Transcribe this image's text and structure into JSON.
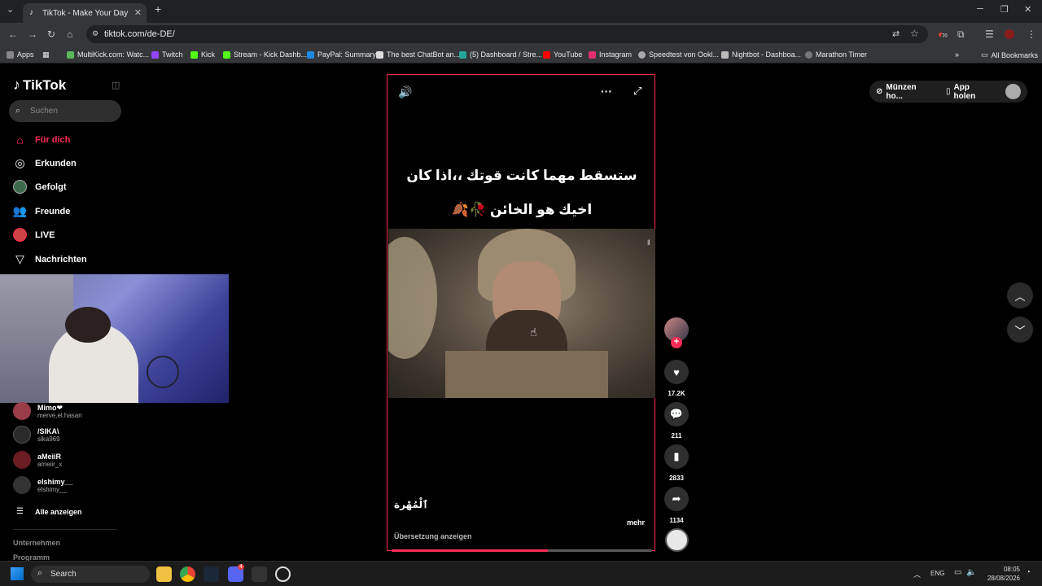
{
  "browser": {
    "tab_title": "TikTok - Make Your Day",
    "url": "tiktok.com/de-DE/",
    "bookmarks": [
      {
        "label": "Apps",
        "color": "#888"
      },
      {
        "label": "MultiKick.com: Watc...",
        "color": "#5cb85c"
      },
      {
        "label": "Twitch",
        "color": "#9146ff"
      },
      {
        "label": "Kick",
        "color": "#53fc18"
      },
      {
        "label": "Stream - Kick Dashb...",
        "color": "#53fc18"
      },
      {
        "label": "PayPal: Summary",
        "color": "#1e88e5"
      },
      {
        "label": "The best ChatBot an...",
        "color": "#ddd"
      },
      {
        "label": "(5) Dashboard / Stre...",
        "color": "#26a69a"
      },
      {
        "label": "YouTube",
        "color": "#ff0000"
      },
      {
        "label": "Instagram",
        "color": "#e1306c"
      },
      {
        "label": "Speedtest von Ookl...",
        "color": "#aaa"
      },
      {
        "label": "Nightbot - Dashboa...",
        "color": "#bbb"
      },
      {
        "label": "Marathon Timer",
        "color": "#777"
      }
    ],
    "all_bookmarks": "All Bookmarks",
    "extension_badge": "70"
  },
  "sidebar": {
    "logo": "TikTok",
    "search_placeholder": "Suchen",
    "nav": [
      {
        "label": "Für dich",
        "icon": "home-icon"
      },
      {
        "label": "Erkunden",
        "icon": "compass-icon"
      },
      {
        "label": "Gefolgt",
        "icon": "following-avatar-icon"
      },
      {
        "label": "Freunde",
        "icon": "friends-icon"
      },
      {
        "label": "LIVE",
        "icon": "live-icon"
      },
      {
        "label": "Nachrichten",
        "icon": "messages-icon"
      }
    ],
    "accounts": [
      {
        "name": "Mimo❤",
        "user": "merve.el.hasan"
      },
      {
        "name": "/SIKA\\",
        "user": "sika969"
      },
      {
        "name": "aMeiiR",
        "user": "ameiir_x"
      },
      {
        "name": "elshimy__",
        "user": "elshimy__"
      }
    ],
    "show_all": "Alle anzeigen",
    "footer": [
      "Unternehmen",
      "Programm"
    ]
  },
  "video": {
    "caption_line1": "ستسقط مهما كانت قوتك ،،اذا كان",
    "caption_line2": "اخيك هو الخائن 🥀🍂",
    "description": "ٱلْمُهْرة",
    "more": "mehr",
    "translate": "Übersetzung anzeigen",
    "progress": 0.6
  },
  "actions": {
    "likes": "17.2K",
    "comments": "211",
    "saves": "2833",
    "shares": "1134"
  },
  "topright": {
    "coins": "Münzen ho...",
    "app": "App holen"
  },
  "taskbar": {
    "search": "Search",
    "lang": "ENG",
    "time": "08:05",
    "date": "28/08/2026",
    "discord_badge": "4"
  }
}
